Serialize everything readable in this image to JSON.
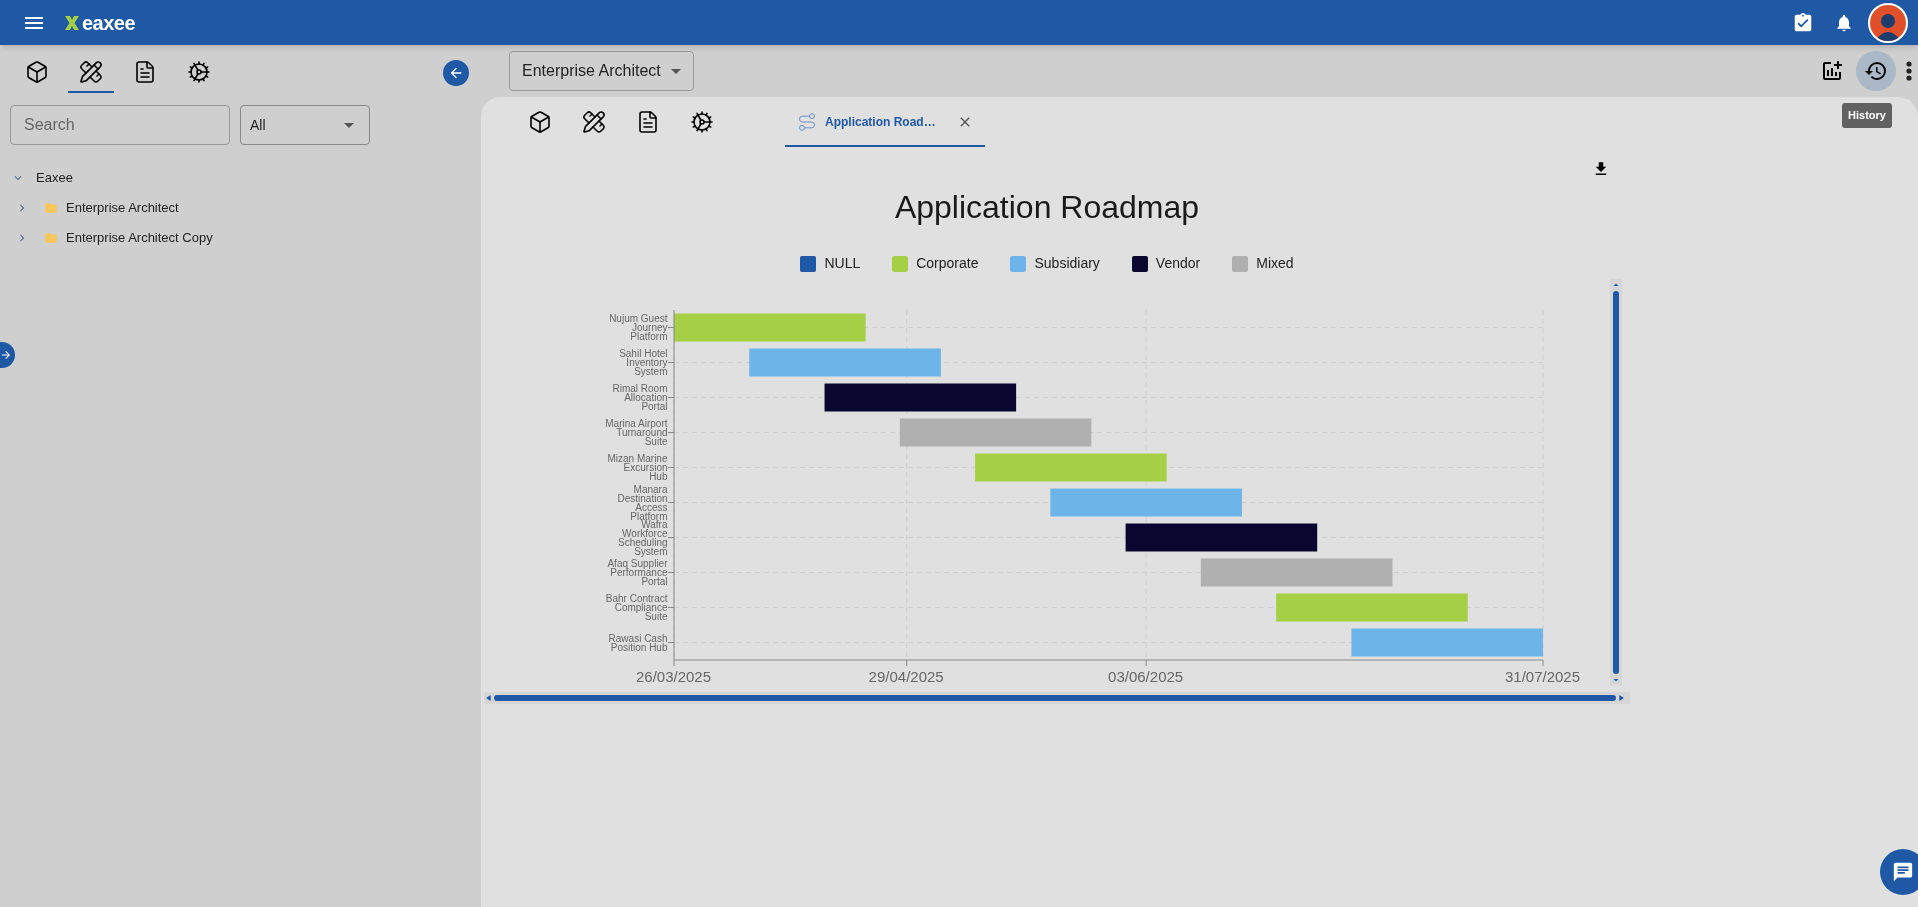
{
  "header": {
    "logo": "eaxee"
  },
  "sidebar": {
    "icon_tabs": [
      {
        "kind": "cube",
        "selected": false
      },
      {
        "kind": "blueprint",
        "selected": true
      },
      {
        "kind": "document",
        "selected": false
      },
      {
        "kind": "gear",
        "selected": false
      }
    ],
    "search": {
      "placeholder": "Search"
    },
    "filter": {
      "value": "All"
    },
    "tree": [
      {
        "label": "Eaxee",
        "expanded": true,
        "children": [
          {
            "label": "Enterprise Architect",
            "expanded": false
          },
          {
            "label": "Enterprise Architect Copy",
            "expanded": false
          }
        ]
      }
    ]
  },
  "toolbar": {
    "workspace": {
      "value": "Enterprise Architect"
    },
    "tooltip": "History"
  },
  "card": {
    "icon_tabs": [
      {
        "kind": "cube",
        "selected": false
      },
      {
        "kind": "blueprint",
        "selected": false
      },
      {
        "kind": "document",
        "selected": false
      },
      {
        "kind": "gear",
        "selected": false
      }
    ],
    "tabs": [
      {
        "label": "Application Road…",
        "selected": true
      }
    ],
    "roadmap": {
      "title": "Application Roadmap",
      "legend": [
        {
          "label": "NULL",
          "color": "#1f58a5"
        },
        {
          "label": "Corporate",
          "color": "#a5cf45"
        },
        {
          "label": "Subsidiary",
          "color": "#6db5e8"
        },
        {
          "label": "Vendor",
          "color": "#0b0630"
        },
        {
          "label": "Mixed",
          "color": "#b0b0b0"
        }
      ],
      "rows": [
        {
          "label": "Nujum Guest Journey Platform",
          "color": "#a5cf45"
        },
        {
          "label": "Sahil Hotel Inventory System",
          "color": "#6db5e8"
        },
        {
          "label": "Rimal Room Allocation Portal",
          "color": "#0b0630"
        },
        {
          "label": "Marina Airport Turnaround Suite",
          "color": "#b0b0b0"
        },
        {
          "label": "Mizan Marine Excursion Hub",
          "color": "#a5cf45"
        },
        {
          "label": "Manara Destination Access Platform",
          "color": "#6db5e8"
        },
        {
          "label": "Wafra Workforce Scheduling System",
          "color": "#0b0630"
        },
        {
          "label": "Afaq Supplier Performance Portal",
          "color": "#b0b0b0"
        },
        {
          "label": "Bahr Contract Compliance Suite",
          "color": "#a5cf45"
        },
        {
          "label": "Rawasi Cash Position Hub",
          "color": "#6db5e8"
        }
      ],
      "date_labels": [
        "26/03/2025",
        "29/04/2025",
        "03/06/2025",
        "31/07/2025"
      ]
    }
  }
}
